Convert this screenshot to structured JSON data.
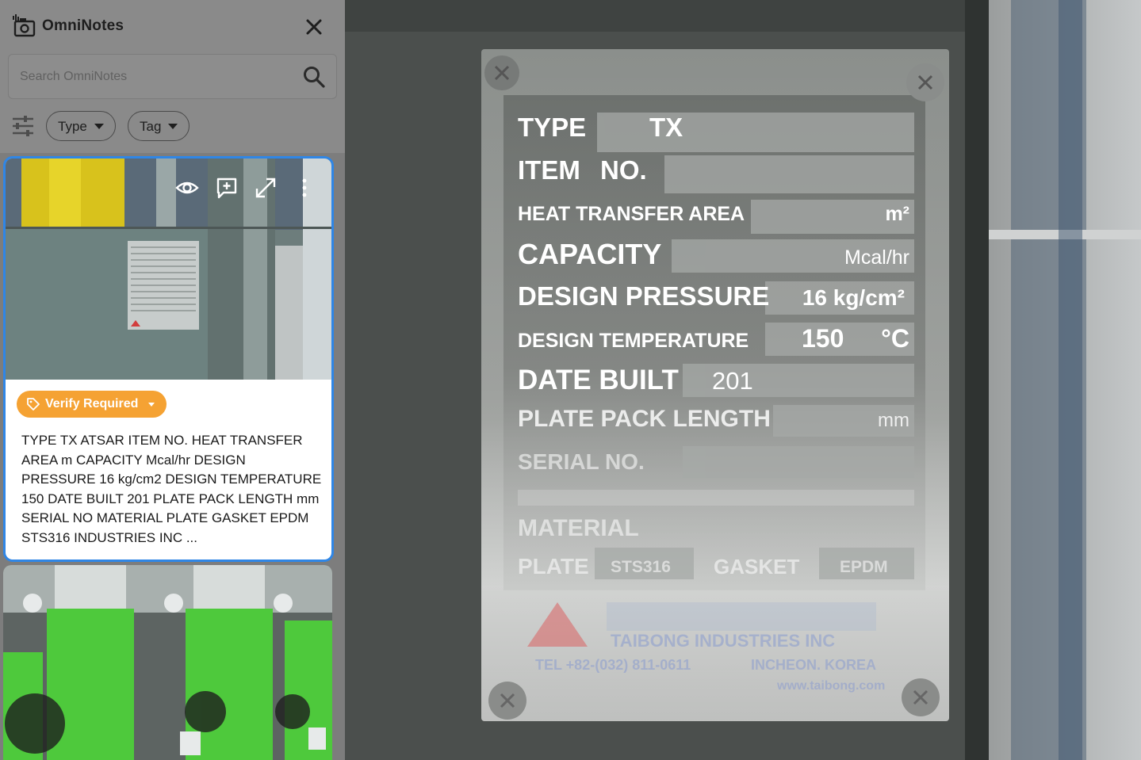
{
  "app": {
    "title": "OmniNotes"
  },
  "search": {
    "placeholder": "Search OmniNotes"
  },
  "filters": {
    "type_label": "Type",
    "tag_label": "Tag"
  },
  "cards": [
    {
      "status_label": "Verify Required",
      "text": "TYPE TX ATSAR ITEM NO. HEAT TRANSFER AREA m CAPACITY Mcal/hr DESIGN PRESSURE 16 kg/cm2 DESIGN TEMPERATURE 150 DATE BUILT 201 PLATE PACK LENGTH mm SERIAL NO MATERIAL PLATE GASKET EPDM STS316 INDUSTRIES INC ..."
    }
  ],
  "plate": {
    "type_label": "TYPE",
    "type_value": "TX",
    "item_label": "ITEM",
    "item_no_label": "NO.",
    "hta_label": "HEAT TRANSFER AREA",
    "hta_unit": "m²",
    "capacity_label": "CAPACITY",
    "capacity_unit": "Mcal/hr",
    "dp_label": "DESIGN PRESSURE",
    "dp_value": "16 kg/cm²",
    "dt_label": "DESIGN TEMPERATURE",
    "dt_value": "150",
    "dt_unit": "°C",
    "db_label": "DATE BUILT",
    "db_value": "201",
    "ppl_label": "PLATE PACK LENGTH",
    "ppl_unit": "mm",
    "serial_label": "SERIAL NO.",
    "material_label": "MATERIAL",
    "plate_label": "PLATE",
    "plate_value": "STS316",
    "gasket_label": "GASKET",
    "gasket_value": "EPDM",
    "company_en": "TAIBONG INDUSTRIES INC",
    "tel": "TEL +82-(032) 811-0611",
    "location": "INCHEON. KOREA",
    "website": "www.taibong.com"
  },
  "icons": {
    "logo": "camera-logo-icon",
    "close": "close-icon",
    "search": "search-icon",
    "filter": "filter-sliders-icon",
    "view": "eye-icon",
    "add": "add-note-icon",
    "expand": "expand-icon",
    "more": "more-vert-icon",
    "tag": "tag-icon"
  },
  "colors": {
    "accent": "#2f86e6",
    "warning": "#f5a233"
  }
}
